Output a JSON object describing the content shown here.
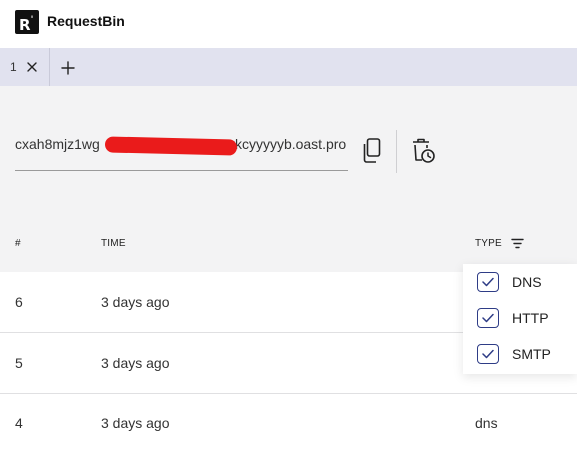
{
  "app": {
    "logo_text": "R",
    "title": "RequestBin"
  },
  "tabs": [
    {
      "label": "1"
    }
  ],
  "endpoint": {
    "url_prefix": "cxah8mjz1wg",
    "url_suffix": "wkcyyyyyb.oast.pro"
  },
  "table": {
    "headers": {
      "index": "#",
      "time": "TIME",
      "type": "TYPE"
    },
    "rows": [
      {
        "index": "6",
        "time": "3 days ago",
        "type": ""
      },
      {
        "index": "5",
        "time": "3 days ago",
        "type": ""
      },
      {
        "index": "4",
        "time": "3 days ago",
        "type": "dns"
      }
    ]
  },
  "type_filter": {
    "options": [
      {
        "label": "DNS",
        "checked": true
      },
      {
        "label": "HTTP",
        "checked": true
      },
      {
        "label": "SMTP",
        "checked": true
      }
    ]
  },
  "colors": {
    "accent": "#2e3c86",
    "tabbar": "#e1e2ef",
    "panel": "#f3f3f4",
    "redaction": "#ea1b1b"
  }
}
